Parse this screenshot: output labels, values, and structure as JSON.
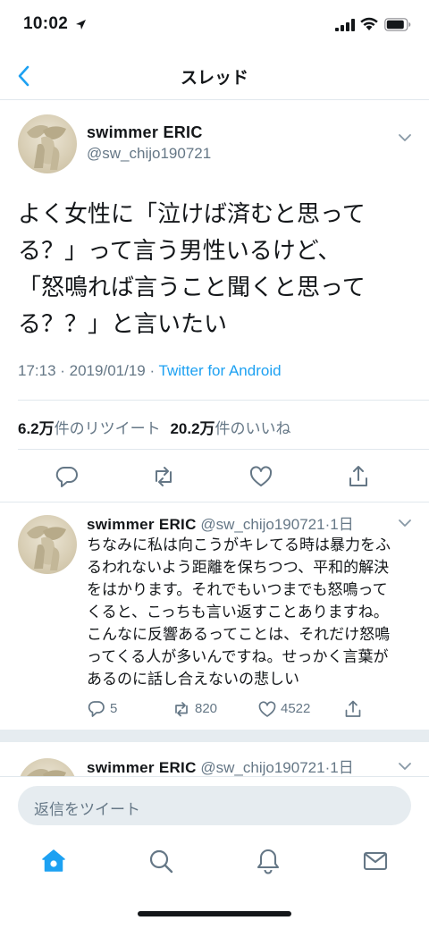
{
  "status_bar": {
    "time": "10:02"
  },
  "nav": {
    "title": "スレッド"
  },
  "main_tweet": {
    "name": "swimmer  ERIC",
    "handle": "@sw_chijo190721",
    "text_lines": [
      "よく女性に「泣けば済むと思って",
      "る？」って言う男性いるけど、",
      "「怒鳴れば言うこと聞くと思って",
      "る？？」と言いたい"
    ],
    "timestamp": "17:13 · 2019/01/19 · ",
    "source": "Twitter for Android",
    "retweets_count": "6.2万",
    "retweets_label": "件のリツイート",
    "likes_count": "20.2万",
    "likes_label": "件のいいね"
  },
  "reply_tweets": [
    {
      "name": "swimmer  ERIC",
      "handle": "@sw_chijo190721",
      "time": "·1日",
      "text_lines": [
        "ちなみに私は向こうがキレてる時は暴力をふ",
        "るわれないよう距離を保ちつつ、平和的解決",
        "をはかります。それでもいつまでも怒鳴って",
        "くると、こっちも言い返すことありますね。",
        "こんなに反響あるってことは、それだけ怒鳴",
        "ってくる人が多いんですね。せっかく言葉が",
        "あるのに話し合えないの悲しい"
      ],
      "replies": "5",
      "retweets": "820",
      "likes": "4522"
    },
    {
      "name": "swimmer  ERIC",
      "handle": "@sw_chijo190721",
      "time": "·1日"
    }
  ],
  "compose": {
    "placeholder": "返信をツイート"
  },
  "colors": {
    "accent": "#1da1f2",
    "secondary_text": "#657786",
    "divider": "#e1e8ed"
  },
  "icons": {
    "tabs": [
      "home-icon",
      "search-icon",
      "notifications-icon",
      "messages-icon"
    ],
    "actions": [
      "reply-icon",
      "retweet-icon",
      "like-icon",
      "share-icon"
    ]
  }
}
